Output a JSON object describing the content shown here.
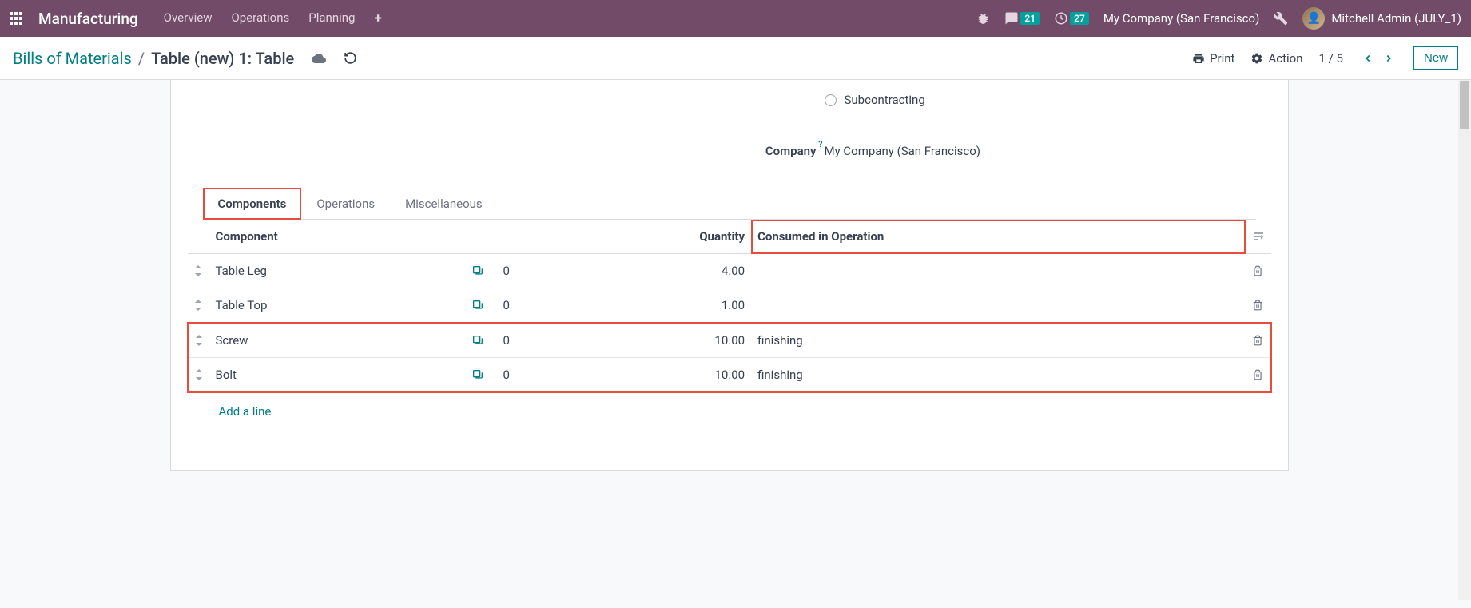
{
  "navbar": {
    "app_name": "Manufacturing",
    "menu": [
      "Overview",
      "Operations",
      "Planning"
    ],
    "messages_badge": "21",
    "activities_badge": "27",
    "company": "My Company (San Francisco)",
    "user": "Mitchell Admin (JULY_1)"
  },
  "breadcrumb": {
    "parent": "Bills of Materials",
    "current": "Table (new) 1: Table",
    "print": "Print",
    "action": "Action",
    "pager": "1 / 5",
    "new_btn": "New"
  },
  "form": {
    "subcontracting_label": "Subcontracting",
    "company_label": "Company",
    "company_value": "My Company (San Francisco)"
  },
  "tabs": {
    "components": "Components",
    "operations": "Operations",
    "miscellaneous": "Miscellaneous"
  },
  "table": {
    "headers": {
      "component": "Component",
      "quantity": "Quantity",
      "consumed": "Consumed in Operation"
    },
    "rows": [
      {
        "name": "Table Leg",
        "sub": "0",
        "qty": "4.00",
        "consumed": ""
      },
      {
        "name": "Table Top",
        "sub": "0",
        "qty": "1.00",
        "consumed": ""
      },
      {
        "name": "Screw",
        "sub": "0",
        "qty": "10.00",
        "consumed": "finishing"
      },
      {
        "name": "Bolt",
        "sub": "0",
        "qty": "10.00",
        "consumed": "finishing"
      }
    ],
    "add_line": "Add a line"
  }
}
